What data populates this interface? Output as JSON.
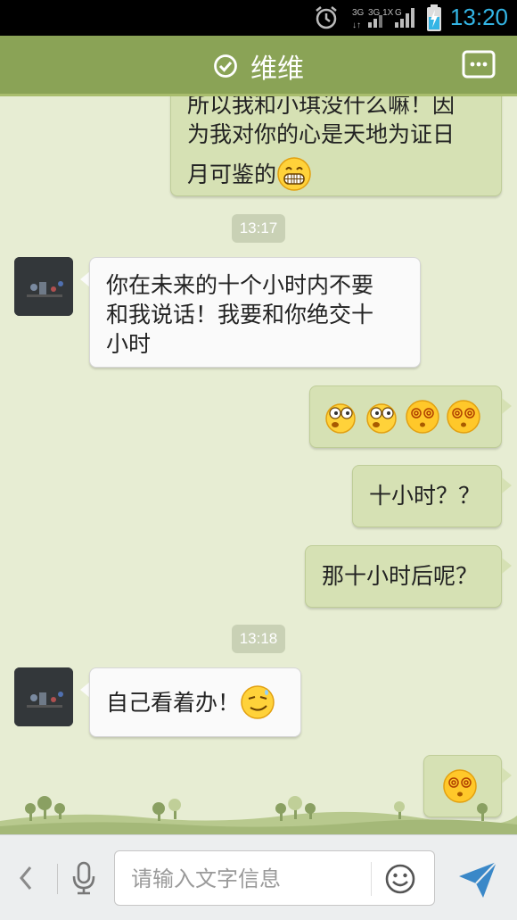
{
  "status_bar": {
    "time": "13:20",
    "network_label_1": "3G",
    "network_label_2": "3G 1X",
    "network_label_3": "G",
    "accent_color": "#33b5e5"
  },
  "header": {
    "title": "维维",
    "online_icon": "check-circle-icon",
    "menu_icon": "more-options-icon",
    "bg_color": "#8aa356"
  },
  "messages": [
    {
      "type": "out",
      "lines": [
        "所以我和小琪没什么嘛！因",
        "为我对你的心是天地为证日",
        "月可鉴的"
      ],
      "emoji": "grin-emoji"
    },
    {
      "type": "time",
      "text": "13:17"
    },
    {
      "type": "in",
      "lines": [
        "你在未来的十个小时内不要",
        "和我说话！我要和你绝交十",
        "小时"
      ]
    },
    {
      "type": "out",
      "emojis": [
        "shocked-emoji",
        "shocked-emoji",
        "dizzy-emoji",
        "dizzy-emoji"
      ]
    },
    {
      "type": "out",
      "text": "十小时？？"
    },
    {
      "type": "out",
      "text": "那十小时后呢？"
    },
    {
      "type": "time",
      "text": "13:18"
    },
    {
      "type": "in",
      "text": "自己看着办！",
      "emoji": "smirk-emoji"
    },
    {
      "type": "out",
      "emojis": [
        "dizzy-emoji"
      ]
    }
  ],
  "input_bar": {
    "placeholder": "请输入文字信息",
    "value": "",
    "back_icon": "chevron-left-icon",
    "mic_icon": "microphone-icon",
    "emoji_icon": "smiley-icon",
    "send_icon": "send-icon"
  }
}
